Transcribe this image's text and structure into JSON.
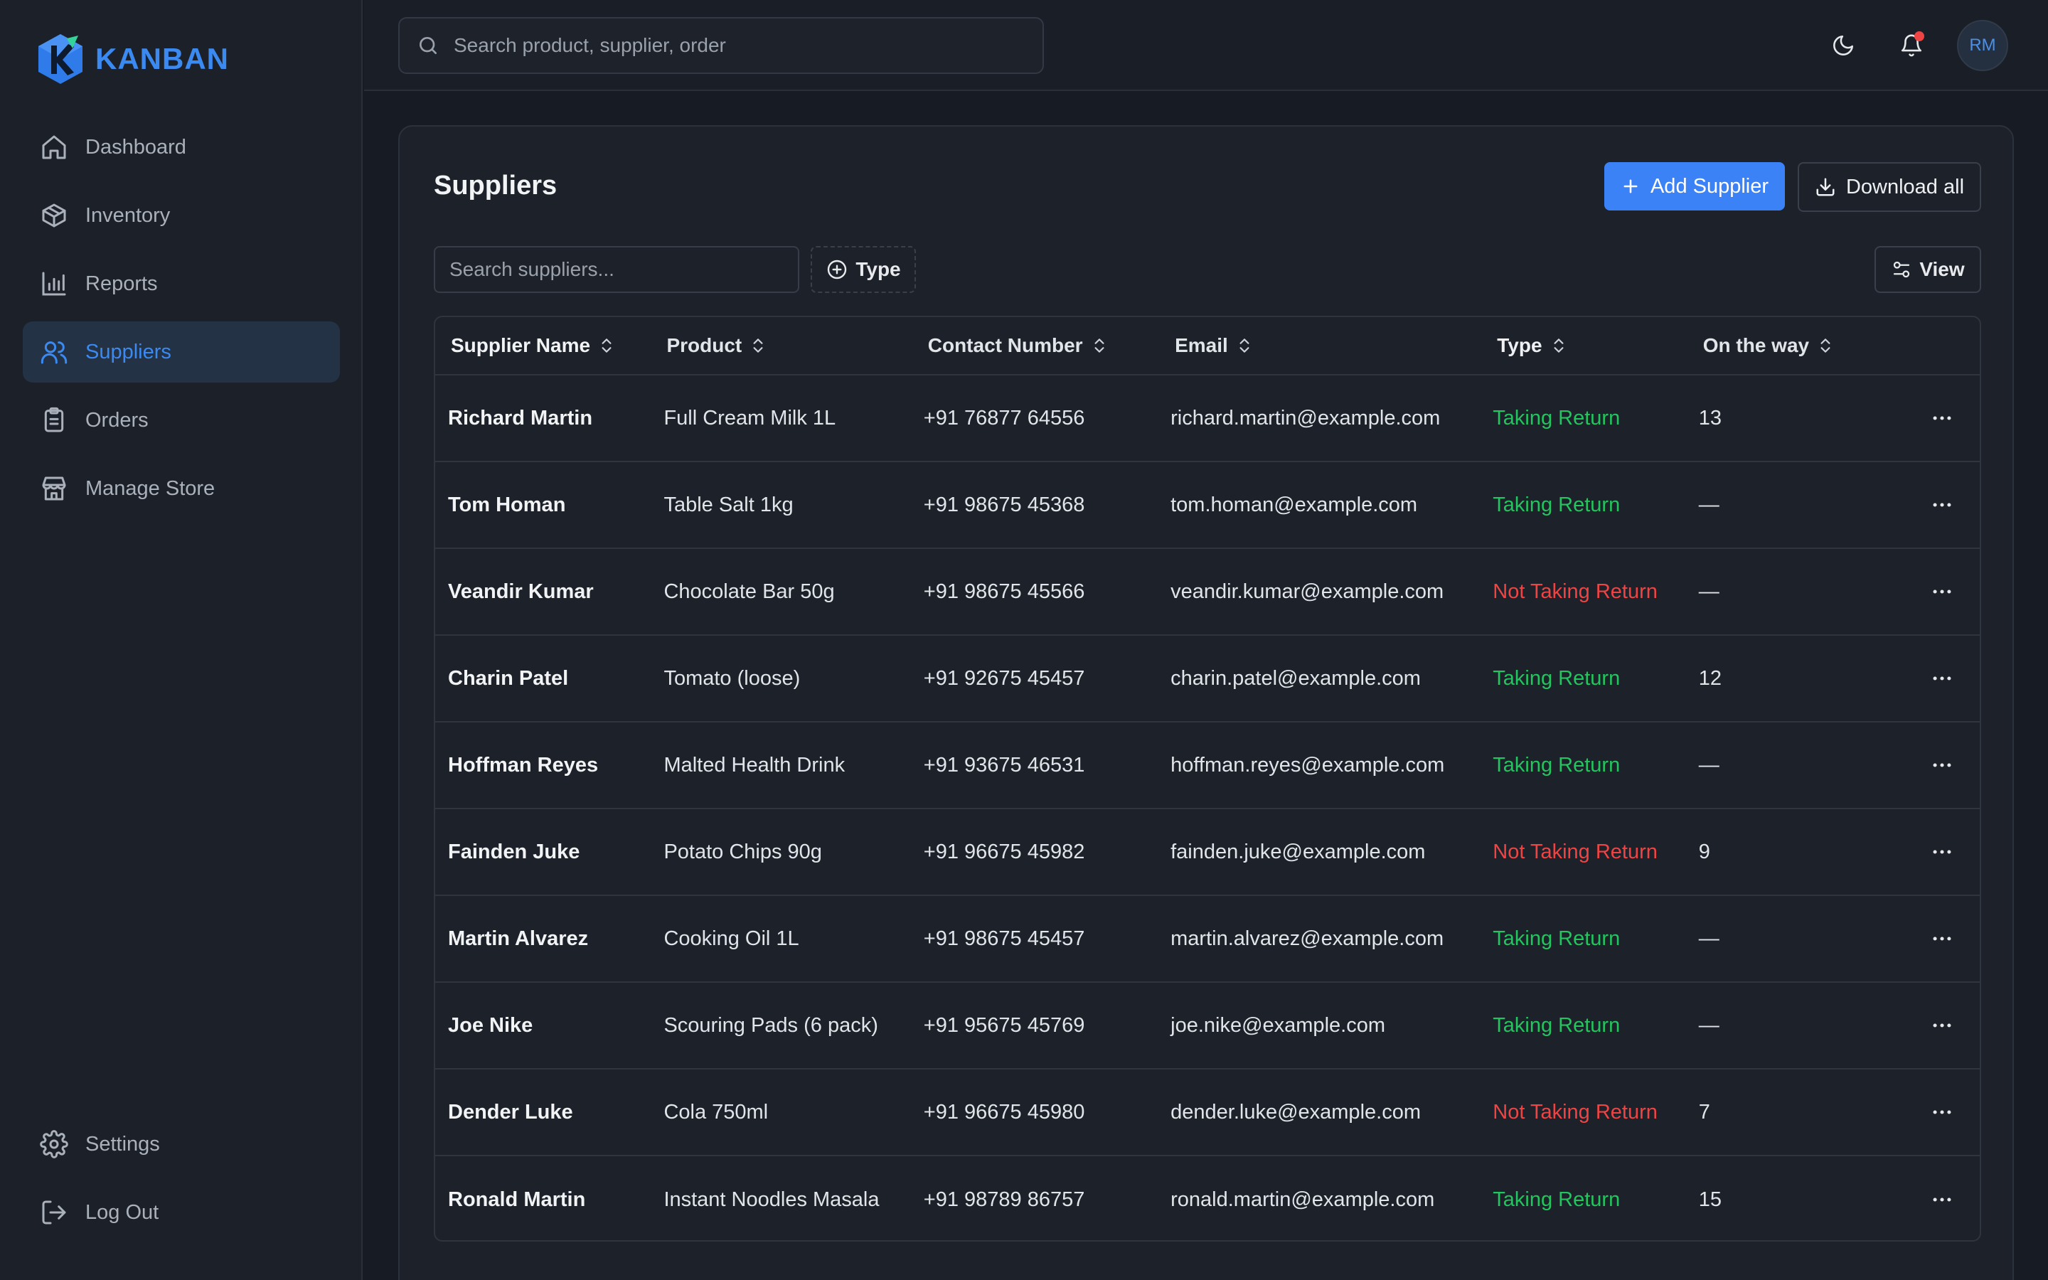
{
  "sidebar": {
    "brand": "KANBAN",
    "items": [
      {
        "label": "Dashboard",
        "icon": "home-icon"
      },
      {
        "label": "Inventory",
        "icon": "package-icon"
      },
      {
        "label": "Reports",
        "icon": "bar-chart-icon"
      },
      {
        "label": "Suppliers",
        "icon": "users-icon",
        "active": true
      },
      {
        "label": "Orders",
        "icon": "clipboard-icon"
      },
      {
        "label": "Manage Store",
        "icon": "store-icon"
      }
    ],
    "bottom": [
      {
        "label": "Settings",
        "icon": "gear-icon"
      },
      {
        "label": "Log Out",
        "icon": "logout-icon"
      }
    ]
  },
  "topbar": {
    "search_placeholder": "Search product, supplier, order",
    "avatar_initials": "RM"
  },
  "page": {
    "title": "Suppliers",
    "add_button": "Add Supplier",
    "download_button": "Download all",
    "filter_placeholder": "Search suppliers...",
    "type_filter": "Type",
    "view_button": "View"
  },
  "table": {
    "columns": [
      "Supplier Name",
      "Product",
      "Contact Number",
      "Email",
      "Type",
      "On the way"
    ],
    "rows": [
      {
        "name": "Richard Martin",
        "product": "Full Cream Milk 1L",
        "phone": "+91 76877 64556",
        "email": "richard.martin@example.com",
        "type": "Taking Return",
        "on_way": "13"
      },
      {
        "name": "Tom Homan",
        "product": "Table Salt 1kg",
        "phone": "+91 98675 45368",
        "email": "tom.homan@example.com",
        "type": "Taking Return",
        "on_way": "—"
      },
      {
        "name": "Veandir Kumar",
        "product": "Chocolate Bar 50g",
        "phone": "+91 98675 45566",
        "email": "veandir.kumar@example.com",
        "type": "Not Taking Return",
        "on_way": "—"
      },
      {
        "name": "Charin Patel",
        "product": "Tomato (loose)",
        "phone": "+91 92675 45457",
        "email": "charin.patel@example.com",
        "type": "Taking Return",
        "on_way": "12"
      },
      {
        "name": "Hoffman Reyes",
        "product": "Malted Health Drink",
        "phone": "+91 93675 46531",
        "email": "hoffman.reyes@example.com",
        "type": "Taking Return",
        "on_way": "—"
      },
      {
        "name": "Fainden Juke",
        "product": "Potato Chips 90g",
        "phone": "+91 96675 45982",
        "email": "fainden.juke@example.com",
        "type": "Not Taking Return",
        "on_way": "9"
      },
      {
        "name": "Martin Alvarez",
        "product": "Cooking Oil 1L",
        "phone": "+91 98675 45457",
        "email": "martin.alvarez@example.com",
        "type": "Taking Return",
        "on_way": "—"
      },
      {
        "name": "Joe Nike",
        "product": "Scouring Pads (6 pack)",
        "phone": "+91 95675 45769",
        "email": "joe.nike@example.com",
        "type": "Taking Return",
        "on_way": "—"
      },
      {
        "name": "Dender Luke",
        "product": "Cola 750ml",
        "phone": "+91 96675 45980",
        "email": "dender.luke@example.com",
        "type": "Not Taking Return",
        "on_way": "7"
      },
      {
        "name": "Ronald Martin",
        "product": "Instant Noodles Masala",
        "phone": "+91 98789 86757",
        "email": "ronald.martin@example.com",
        "type": "Taking Return",
        "on_way": "15"
      }
    ]
  },
  "colors": {
    "accent": "#3b82f6",
    "taking_return": "#22c55e",
    "not_taking_return": "#ef4444"
  }
}
